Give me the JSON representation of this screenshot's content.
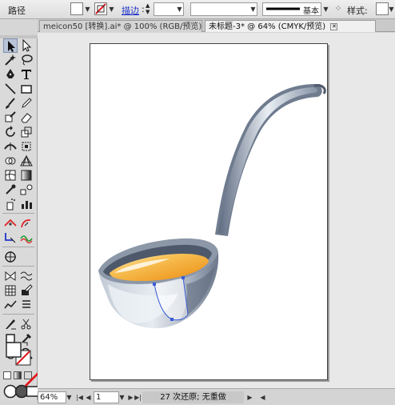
{
  "control_bar": {
    "path_label": "路径",
    "stroke_link": "描边",
    "stroke_width_value": "",
    "brush_value": "基本",
    "style_label": "样式:"
  },
  "tabs": [
    {
      "label": "meicon50 [转换].ai* @ 100% (RGB/预览)",
      "active": false
    },
    {
      "label": "未标题-3* @ 64% (CMYK/预览)",
      "active": true
    }
  ],
  "status_bar": {
    "zoom": "64%",
    "artboard_number": "1",
    "status_text": "27 次还原; 无重做"
  },
  "colors": {
    "accent_stroke_red": "#e0141a",
    "selection_blue": "#3a5bd6",
    "soup_orange": "#f19a1a"
  }
}
